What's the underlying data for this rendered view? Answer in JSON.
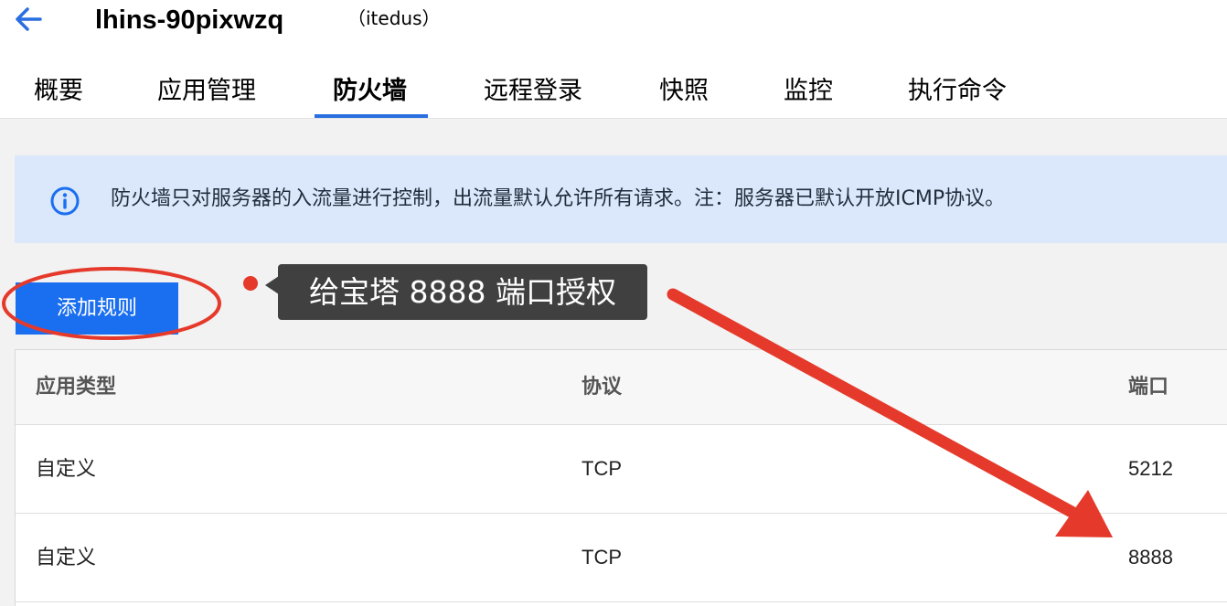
{
  "header": {
    "instance_name": "lhins-90pixwzq",
    "instance_alias": "（itedus）"
  },
  "tabs": [
    {
      "label": "概要",
      "active": false
    },
    {
      "label": "应用管理",
      "active": false
    },
    {
      "label": "防火墙",
      "active": true
    },
    {
      "label": "远程登录",
      "active": false
    },
    {
      "label": "快照",
      "active": false
    },
    {
      "label": "监控",
      "active": false
    },
    {
      "label": "执行命令",
      "active": false
    }
  ],
  "notice": {
    "icon": "info-icon",
    "text": "防火墙只对服务器的入流量进行控制，出流量默认允许所有请求。注：服务器已默认开放ICMP协议。"
  },
  "toolbar": {
    "add_rule_label": "添加规则"
  },
  "annotation": {
    "tooltip_text": "给宝塔 8888 端口授权"
  },
  "table": {
    "columns": [
      "应用类型",
      "协议",
      "端口"
    ],
    "rows": [
      {
        "type": "自定义",
        "protocol": "TCP",
        "port": "5212"
      },
      {
        "type": "自定义",
        "protocol": "TCP",
        "port": "8888"
      }
    ]
  },
  "colors": {
    "accent": "#1a6ff0",
    "tab_underline": "#2a6fe0",
    "notice_bg": "#dbe8fb",
    "annotation_red": "#e53a2b",
    "tooltip_bg": "#404040"
  }
}
